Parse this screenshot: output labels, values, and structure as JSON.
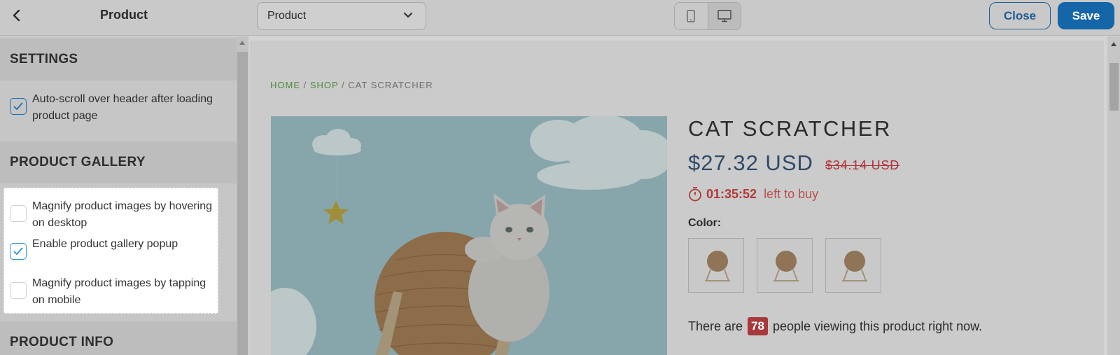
{
  "topbar": {
    "title": "Product",
    "page_select_value": "Product",
    "close_label": "Close",
    "save_label": "Save"
  },
  "sidebar": {
    "settings_heading": "SETTINGS",
    "settings_options": [
      {
        "label": "Auto-scroll over header after loading product page",
        "checked": true
      }
    ],
    "gallery_heading": "PRODUCT GALLERY",
    "gallery_options": [
      {
        "label": "Magnify product images by hovering on desktop",
        "checked": false
      },
      {
        "label": "Enable product gallery popup",
        "checked": true
      },
      {
        "label": "Magnify product images by tapping on mobile",
        "checked": false
      }
    ],
    "info_heading": "PRODUCT INFO"
  },
  "preview": {
    "breadcrumb": {
      "home": "HOME",
      "sep1": " / ",
      "shop": "SHOP",
      "sep2": " / ",
      "current": "CAT SCRATCHER"
    },
    "product_title": "CAT SCRATCHER",
    "price": "$27.32 USD",
    "compare_price": "$34.14 USD",
    "countdown": "01:35:52",
    "countdown_suffix": "left to buy",
    "color_label": "Color:",
    "viewers_prefix": "There are",
    "viewers_count": "78",
    "viewers_suffix": "people viewing this product right now."
  },
  "colors": {
    "accent": "#1466a8",
    "price": "#2f4b68",
    "sale": "#b0323b",
    "breadcrumb_link": "#4f8a3c"
  }
}
